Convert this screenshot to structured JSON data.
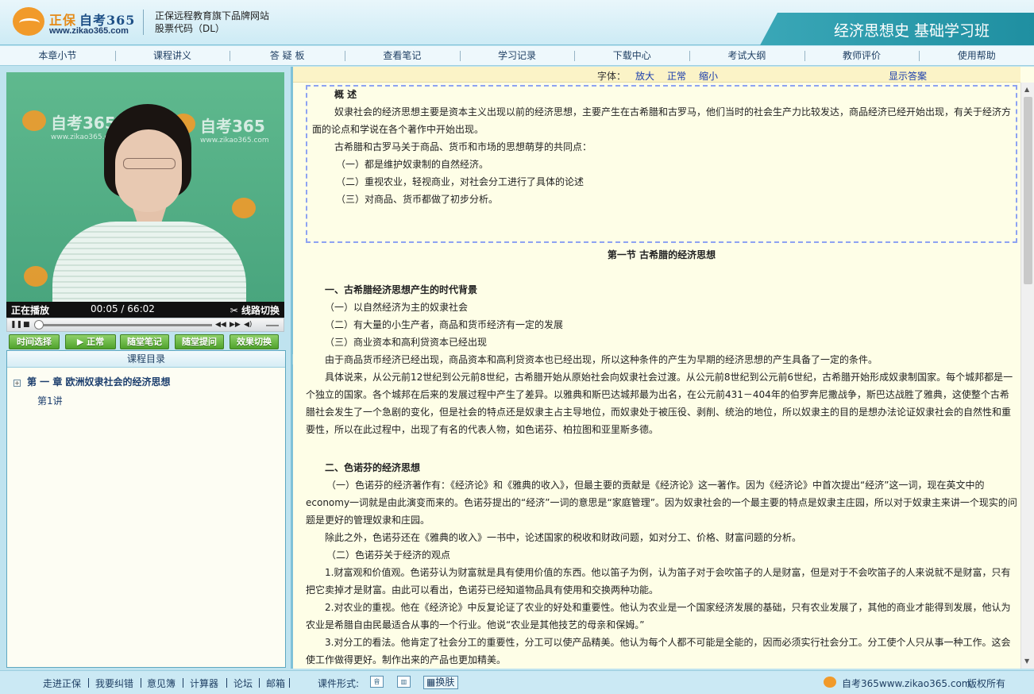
{
  "header": {
    "brand_cn": "正保",
    "brand_name": "自考365",
    "url": "www.zikao365.com",
    "slogan_line1": "正保远程教育旗下品牌网站",
    "slogan_line2": "股票代码（DL）",
    "course_title": "经济思想史 基础学习班"
  },
  "nav": [
    "本章小节",
    "课程讲义",
    "答 疑 板",
    "查看笔记",
    "学习记录",
    "下载中心",
    "考试大纲",
    "教师评价",
    "使用帮助"
  ],
  "video": {
    "watermark": "自考365",
    "watermark_url": "www.zikao365.com",
    "status": "正在播放",
    "current_time": "00:05",
    "sep": "/",
    "total_time": "66:02",
    "route_switch": "线路切换",
    "progress": 0.002
  },
  "buttons": [
    "时间选择",
    "正常",
    "随堂笔记",
    "随堂提问",
    "效果切换"
  ],
  "catalog": {
    "title": "课程目录",
    "chapter": "第 一 章   欧洲奴隶社会的经济思想",
    "lesson": "第1讲"
  },
  "fontbar": {
    "label": "字体：",
    "enlarge": "放大",
    "normal": "正常",
    "shrink": "缩小",
    "show_answer": "显示答案"
  },
  "content": {
    "overview_title": "概    述",
    "overview_p1": "奴隶社会的经济思想主要是资本主义出现以前的经济思想，主要产生在古希腊和古罗马，他们当时的社会生产力比较发达，商品经济已经开始出现，有关于经济方面的论点和学说在各个著作中开始出现。",
    "overview_p2": "古希腊和古罗马关于商品、货币和市场的思想萌芽的共同点：",
    "overview_l1": "（一）都是维护奴隶制的自然经济。",
    "overview_l2": "（二）重视农业，轻视商业，对社会分工进行了具体的论述",
    "overview_l3": "（三）对商品、货币都做了初步分析。",
    "section_title": "第一节   古希腊的经济思想",
    "h1": "一、古希腊经济思想产生的时代背景",
    "h1_l1": "（一）以自然经济为主的奴隶社会",
    "h1_l2": "（二）有大量的小生产者，商品和货币经济有一定的发展",
    "h1_l3": "（三）商业资本和高利贷资本已经出现",
    "h1_p1": "由于商品货币经济已经出现，商品资本和高利贷资本也已经出现，所以这种条件的产生为早期的经济思想的产生具备了一定的条件。",
    "h1_p2": "具体说来，从公元前12世纪到公元前8世纪，古希腊开始从原始社会向奴隶社会过渡。从公元前8世纪到公元前6世纪，古希腊开始形成奴隶制国家。每个城邦都是一个独立的国家。各个城邦在后来的发展过程中产生了差异。以雅典和斯巴达城邦最为出名，在公元前431－404年的伯罗奔尼撒战争，斯巴达战胜了雅典，这使整个古希腊社会发生了一个急剧的变化，但是社会的特点还是奴隶主占主导地位，而奴隶处于被压役、剥削、统治的地位，所以奴隶主的目的是想办法论证奴隶社会的自然性和重要性，所以在此过程中，出现了有名的代表人物，如色诺芬、柏拉图和亚里斯多德。",
    "h2": "二、色诺芬的经济思想",
    "h2_p1": "（一）色诺芬的经济著作有：《经济论》和《雅典的收入》，但最主要的贡献是《经济论》这一著作。因为《经济论》中首次提出“经济”这一词，现在英文中的economy一词就是由此演变而来的。色诺芬提出的“经济”一词的意思是“家庭管理”。因为奴隶社会的一个最主要的特点是奴隶主庄园，所以对于奴隶主来讲一个现实的问题是更好的管理奴隶和庄园。",
    "h2_p2": "除此之外，色诺芬还在《雅典的收入》一书中，论述国家的税收和财政问题，如对分工、价格、财富问题的分析。",
    "h2_l2": "（二）色诺芬关于经济的观点",
    "h2_p3": "1.财富观和价值观。色诺芬认为财富就是具有使用价值的东西。他以笛子为例，认为笛子对于会吹笛子的人是财富，但是对于不会吹笛子的人来说就不是财富，只有把它卖掉才是财富。由此可以看出，色诺芬已经知道物品具有使用和交换两种功能。",
    "h2_p4": "2.对农业的重视。他在《经济论》中反复论证了农业的好处和重要性。他认为农业是一个国家经济发展的基础，只有农业发展了，其他的商业才能得到发展，他认为农业是希腊自由民最适合从事的一个行业。他说“农业是其他技艺的母亲和保姆。”",
    "h2_p5": "3.对分工的看法。他肯定了社会分工的重要性，分工可以使产品精美。他认为每个人都不可能是全能的，因而必须实行社会分工。分工使个人只从事一种工作。这会使工作做得更好。制作出来的产品也更加精美。"
  },
  "footer": {
    "links": [
      "走进正保",
      "我要纠错",
      "意见簿",
      "计算器",
      "论坛",
      "邮箱"
    ],
    "form_label": "课件形式:",
    "skin": "换肤",
    "site": "自考365www.zikao365.com",
    "copyright": "版权所有"
  },
  "colors": {
    "accent": "#1f8fa1",
    "content_bg": "#fefee7",
    "link": "#1a3dad",
    "button_green": "#4fa22b"
  }
}
